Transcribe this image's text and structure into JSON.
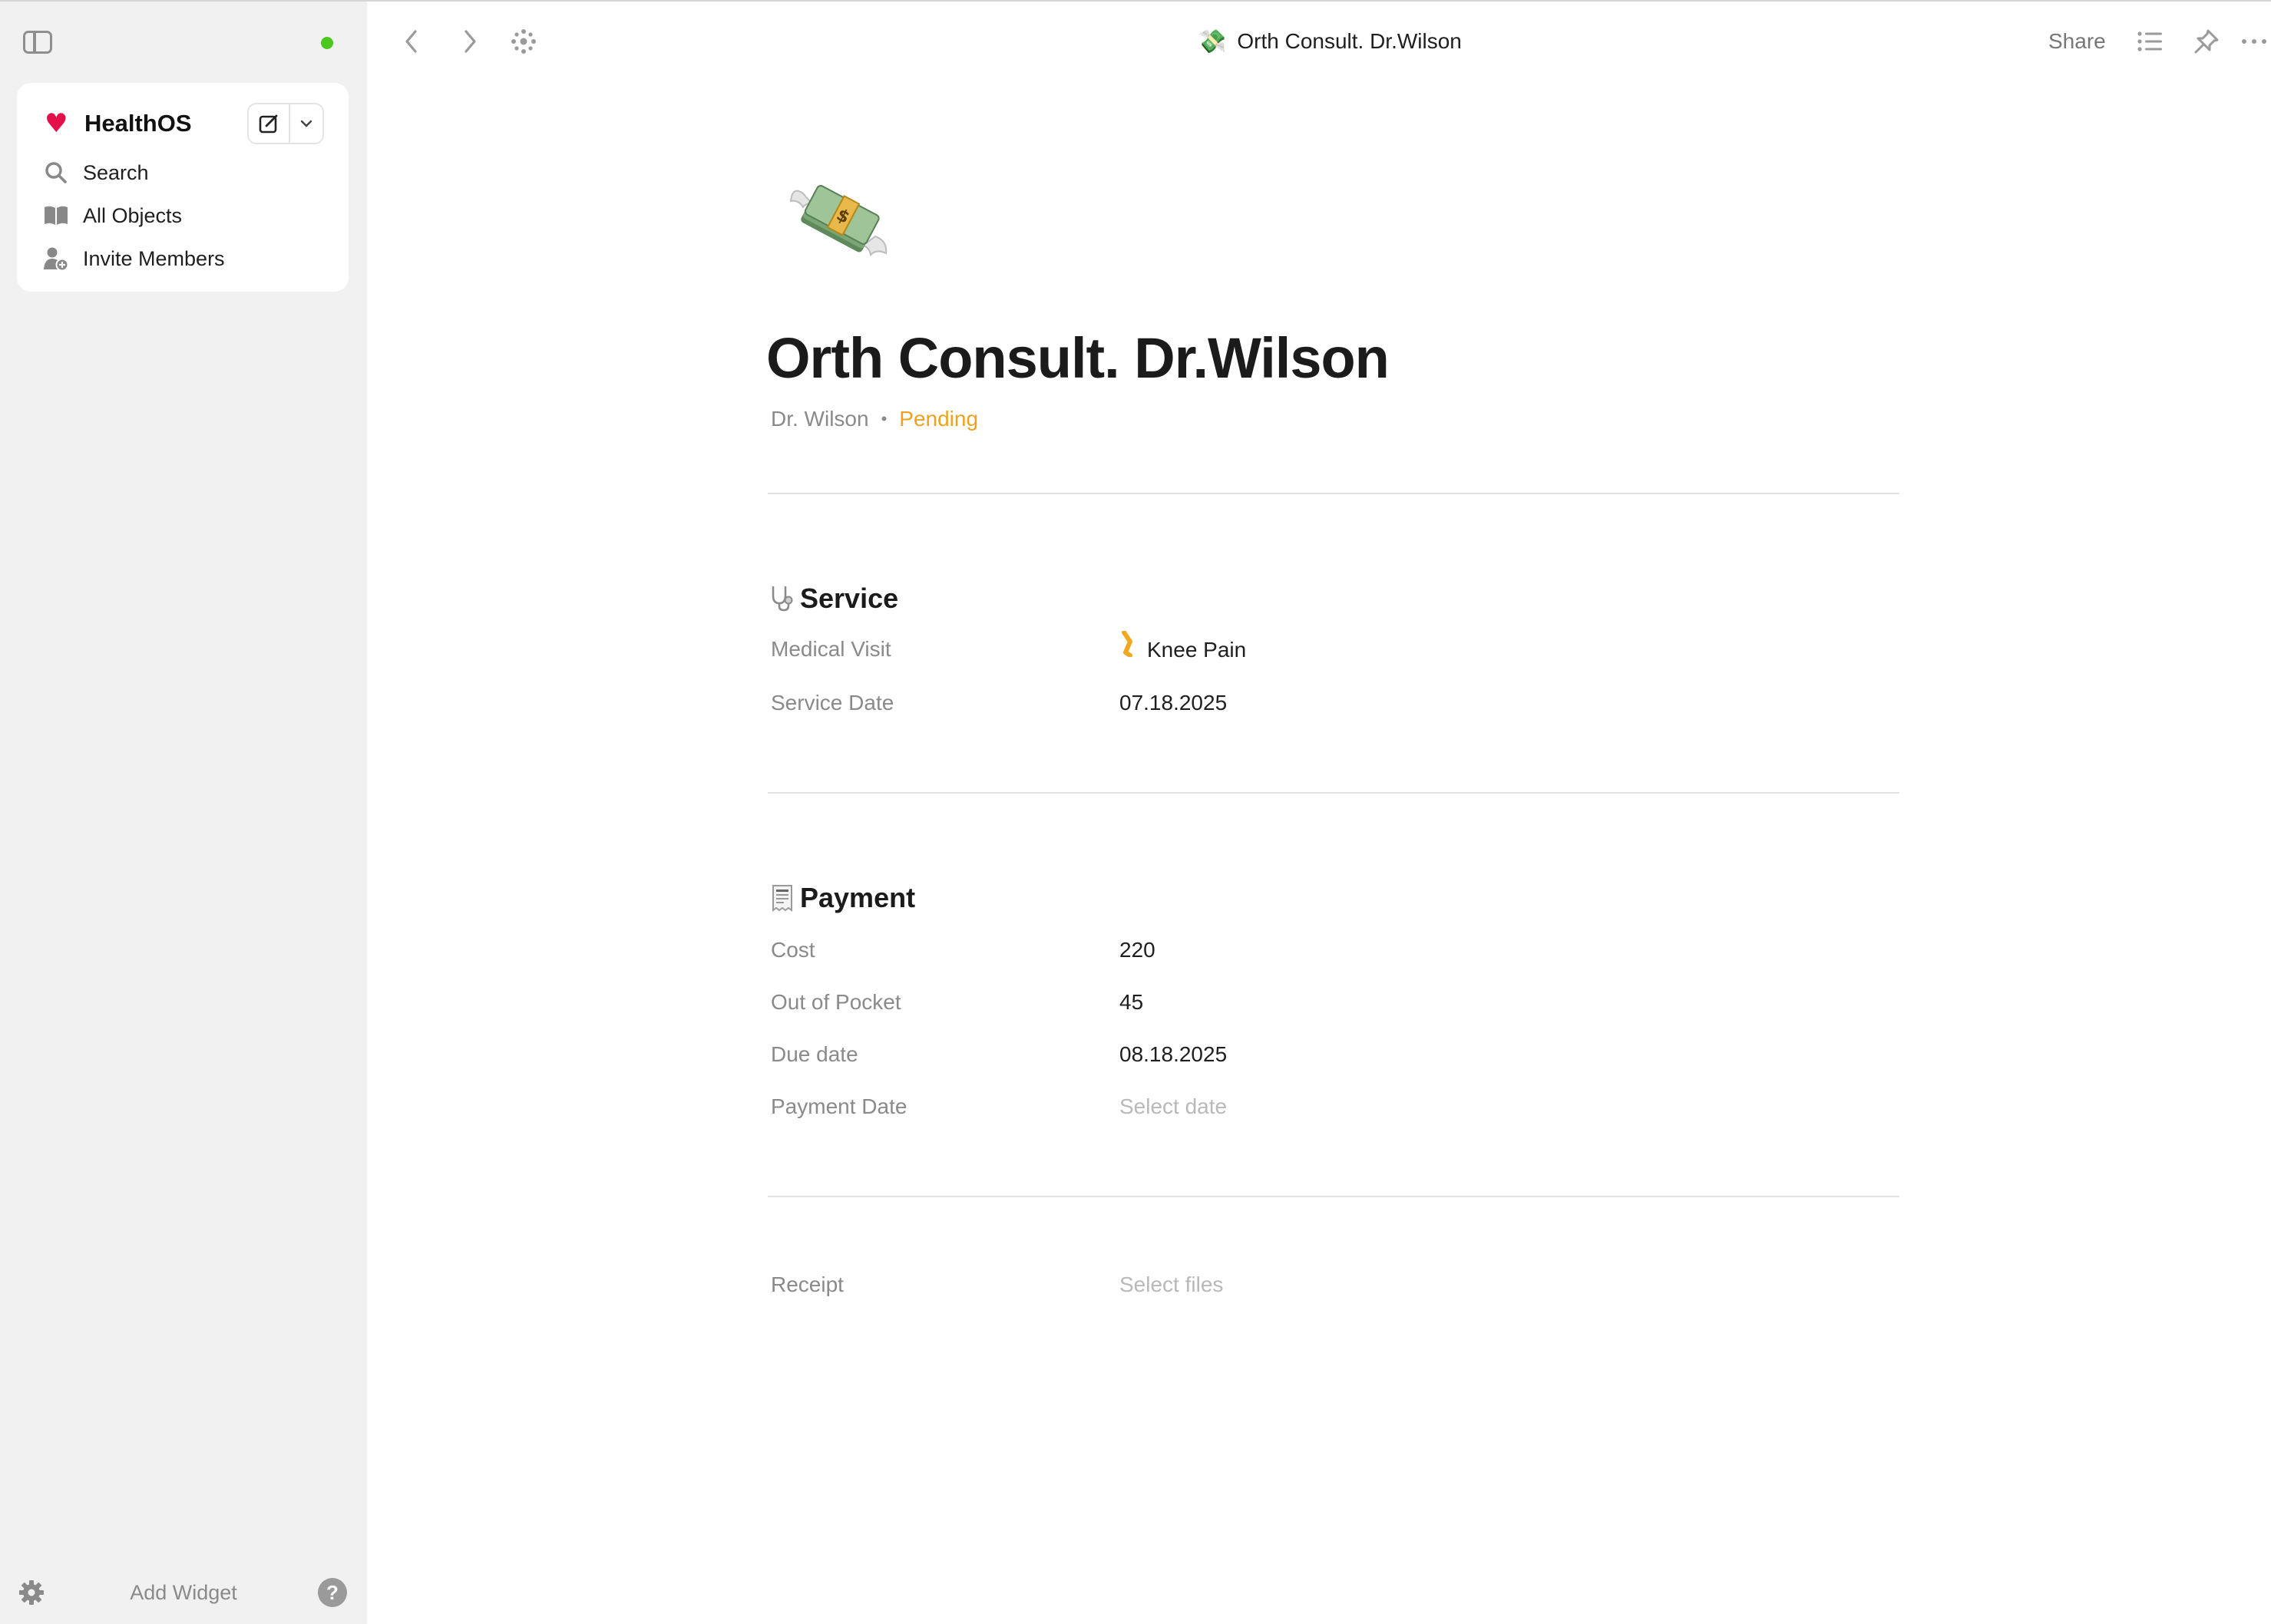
{
  "sidebar": {
    "space_name": "HealthOS",
    "nav": [
      {
        "label": "Search",
        "icon": "search-icon"
      },
      {
        "label": "All Objects",
        "icon": "book-icon"
      },
      {
        "label": "Invite Members",
        "icon": "invite-user-icon"
      }
    ],
    "add_widget_label": "Add Widget",
    "status_color": "#4cc71e",
    "accent_heart_color": "#e3104a"
  },
  "toolbar": {
    "page_emoji": "💸",
    "page_title": "Orth Consult. Dr.Wilson",
    "share_label": "Share"
  },
  "document": {
    "cover_emoji": "money-with-wings",
    "title": "Orth Consult. Dr.Wilson",
    "author": "Dr. Wilson",
    "separator": "•",
    "status": "Pending",
    "status_color": "#f0a21e",
    "sections": {
      "service": {
        "title": "Service",
        "icon": "stethoscope-icon",
        "rows": [
          {
            "label": "Medical Visit",
            "value": "Knee Pain",
            "value_emoji": "🦵"
          },
          {
            "label": "Service Date",
            "value": "07.18.2025"
          }
        ]
      },
      "payment": {
        "title": "Payment",
        "icon": "receipt-icon",
        "rows": [
          {
            "label": "Cost",
            "value": "220"
          },
          {
            "label": "Out of Pocket",
            "value": "45"
          },
          {
            "label": "Due date",
            "value": "08.18.2025"
          },
          {
            "label": "Payment Date",
            "placeholder": "Select date"
          }
        ]
      },
      "receipt": {
        "label": "Receipt",
        "placeholder": "Select files"
      }
    }
  }
}
